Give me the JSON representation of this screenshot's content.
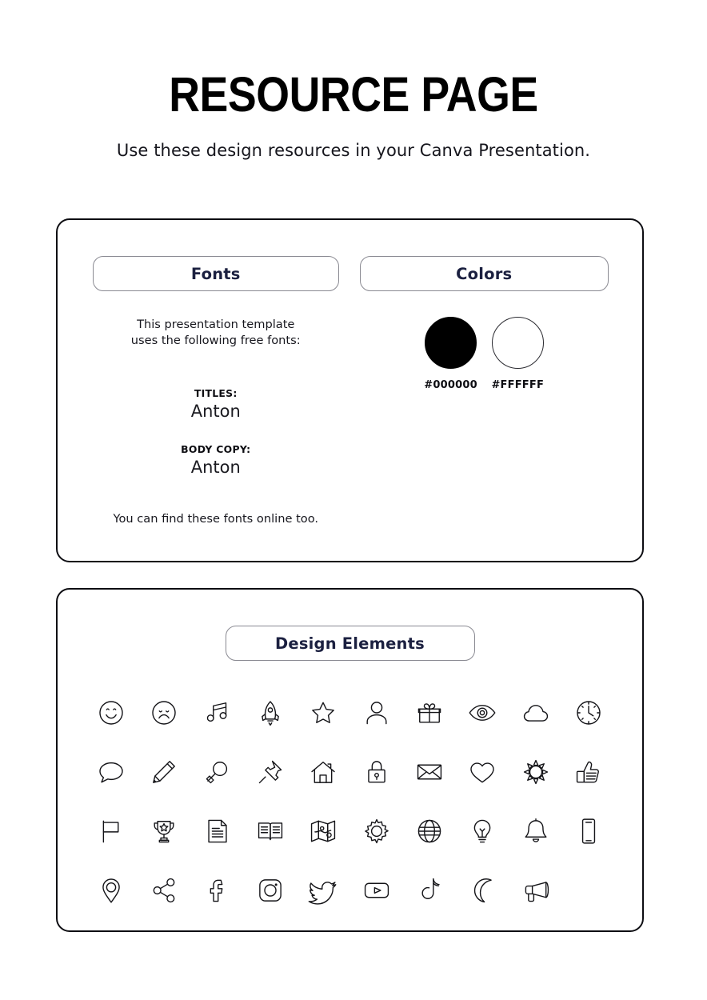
{
  "header": {
    "title": "RESOURCE PAGE",
    "subtitle": "Use these design resources in your Canva Presentation."
  },
  "fonts_panel": {
    "heading": "Fonts",
    "intro_line1": "This presentation template",
    "intro_line2": "uses the following free fonts:",
    "titles_label": "TITLES:",
    "titles_font": "Anton",
    "body_label": "BODY COPY:",
    "body_font": "Anton",
    "footnote": "You can find these fonts online too."
  },
  "colors_panel": {
    "heading": "Colors",
    "swatches": [
      {
        "hex": "#000000",
        "fill": "#000000",
        "name": "black-swatch"
      },
      {
        "hex": "#FFFFFF",
        "fill": "#FFFFFF",
        "name": "white-swatch"
      }
    ]
  },
  "design_elements_panel": {
    "heading": "Design Elements",
    "icons": [
      "smiley-face-icon",
      "sad-face-icon",
      "music-note-icon",
      "rocket-icon",
      "star-icon",
      "person-icon",
      "gift-icon",
      "eye-icon",
      "cloud-icon",
      "clock-icon",
      "speech-bubble-icon",
      "pencil-icon",
      "magnifying-glass-icon",
      "push-pin-icon",
      "house-icon",
      "lock-icon",
      "envelope-icon",
      "heart-icon",
      "sun-icon",
      "thumbs-up-icon",
      "flag-icon",
      "trophy-icon",
      "document-icon",
      "open-book-icon",
      "map-icon",
      "gear-icon",
      "globe-icon",
      "lightbulb-icon",
      "bell-icon",
      "mobile-phone-icon",
      "location-pin-icon",
      "share-icon",
      "facebook-icon",
      "instagram-icon",
      "twitter-icon",
      "youtube-icon",
      "tiktok-icon",
      "moon-icon",
      "megaphone-icon"
    ]
  }
}
